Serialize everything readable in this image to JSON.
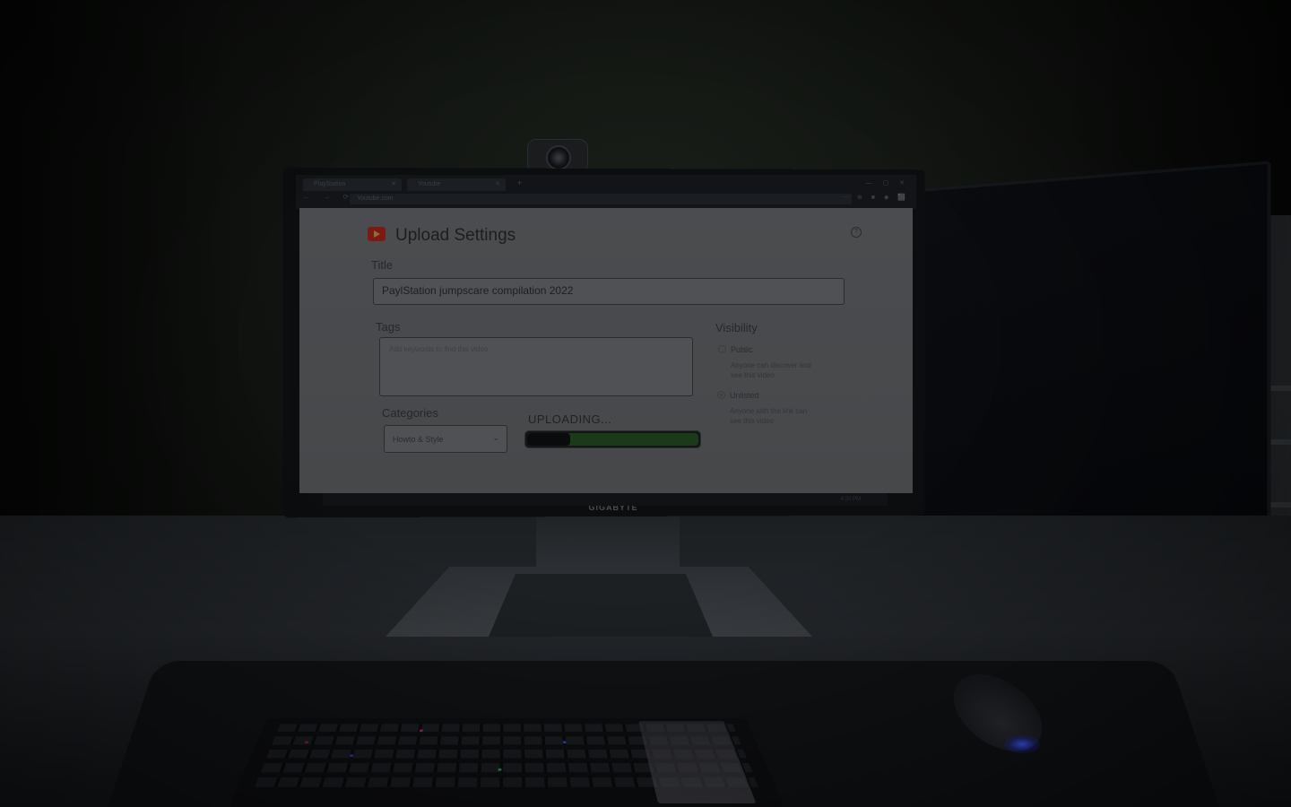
{
  "browser": {
    "tabs": [
      {
        "label": "PlayStation"
      },
      {
        "label": "Youtube"
      }
    ],
    "new_tab_label": "+",
    "address": "Youtube.com",
    "nav_icons": "← → ⟳",
    "ext_icons": "⋯ ⊕ ■ ◆ ⬛",
    "window_controls": "— ▢ ✕"
  },
  "page": {
    "title": "Upload Settings",
    "help_icon": "?",
    "title_field": {
      "label": "Title",
      "value": "PaylStation jumpscare compilation 2022"
    },
    "tags_field": {
      "label": "Tags",
      "placeholder": "Add keywords to find this video"
    },
    "categories": {
      "label": "Categories",
      "selected": "Howto & Style"
    },
    "upload": {
      "status": "UPLOADING...",
      "progress": 0.25
    },
    "visibility": {
      "label": "Visibility",
      "options": [
        {
          "label": "Public",
          "description": "Anyone can discover and see this video",
          "selected": false
        },
        {
          "label": "Unlisted",
          "description": "Anyone with the link can see this video",
          "selected": true
        }
      ]
    }
  },
  "monitor": {
    "brand": "GIGABYTE"
  },
  "taskbar": {
    "clock": "4:20 PM"
  },
  "colors": {
    "logo": "#7a1a12",
    "progress_track": "#1a3a1a",
    "mouse_light": "#3a58ff"
  }
}
